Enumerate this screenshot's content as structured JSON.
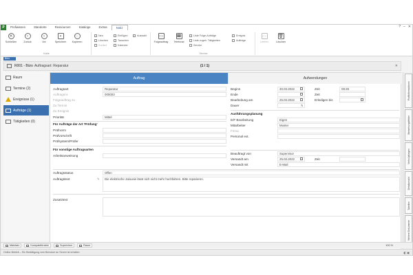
{
  "menu": {
    "tabs": [
      "Profiwissen",
      "Standorte",
      "Ressourcen",
      "Kataloge",
      "Extras",
      "Notiz"
    ],
    "active_index": 5
  },
  "ribbon": {
    "group_main": {
      "buttons": [
        "Schließen",
        "Zurück",
        "Vor",
        "Speichern",
        "Kopieren"
      ],
      "small": [
        "Neu",
        "Löschen",
        "Sortiert"
      ],
      "label": "Karte"
    },
    "group_edit": {
      "small": [
        "Einfügen",
        "Tauschen",
        "Kalender",
        "Auswahl"
      ],
      "label": ""
    },
    "group_service": {
      "buttons": [
        "Folgeauftrag",
        "Telefonat"
      ],
      "small": [
        "Liste Folge-Aufträge",
        "Liste zugeh. Tätigkeiten",
        "Service",
        "Ereignis",
        "Aufträge"
      ],
      "label": "Service"
    },
    "group_right": {
      "buttons": [
        "Leeren",
        "Löschen"
      ]
    }
  },
  "doc_tab": "Büro",
  "header": {
    "title": "R001 - Büro",
    "subtitle": "Auftragsart: Reparatur",
    "page": "(1 / 1)",
    "close": "✕"
  },
  "sidebar": {
    "items": [
      {
        "label": "Raum",
        "icon": "room-icon"
      },
      {
        "label": "Termine (2)",
        "icon": "calendar-icon"
      },
      {
        "label": "Ereignisse (1)",
        "icon": "warning-icon"
      },
      {
        "label": "Aufträge (1)",
        "icon": "order-icon",
        "active": true
      },
      {
        "label": "Tätigkeiten (0)",
        "icon": "activity-icon"
      }
    ]
  },
  "tabs": {
    "auftrag": "Auftrag",
    "aufwendungen": "Aufwendungen"
  },
  "left_form": {
    "auftragsart_label": "Auftragsart",
    "auftragsart_value": "Reparatur",
    "auftragsnr_label": "Auftragsnr.",
    "auftragsnr_value": "000003",
    "folgeauftrag_label": "Folgeauftrag zu",
    "zu_termin_label": "Zu Termin",
    "zu_ereignis_label": "Zu Ereignis",
    "prioritaet_label": "Priorität",
    "prioritaet_value": "Mittel",
    "pruefung_heading": "Für Aufträge der Art 'Prüfung'",
    "pruefnorm_label": "Prüfnorm",
    "pruefvorschrift_label": "Prüfvorschrift",
    "pruefsystem_label": "Prüfsystem/Prüfer",
    "sonstige_heading": "Für sonstige Auftragsarten",
    "arbeitsanweisung_label": "Arbeitsanweisung"
  },
  "right_form": {
    "beginn_label": "Beginn",
    "beginn_value": "30.03.2022",
    "zeit1_label": "Zeit",
    "zeit1_value": "09:28",
    "ende_label": "Ende",
    "zeit2_label": "Zeit",
    "bearb_label": "Bearbeitung am",
    "bearb_value": "25.03.2022",
    "erledigen_label": "Erledigen bis",
    "dauer_label": "Dauer",
    "dauer_unit": "h",
    "planung_heading": "Ausführungsplanung",
    "ef_label": "E/F Bearbeitung",
    "ef_value": "Eigen",
    "mitarbeiter_label": "Mitarbeiter",
    "mitarbeiter_value": "Muster",
    "firma_label": "Firma",
    "personal_label": "Personal ext.",
    "beauftragt_von_label": "Beauftragt von",
    "beauftragt_von_value": "Supervisor",
    "versandt_am_label": "Versandt am",
    "versandt_am_value": "25.03.2022",
    "zeit3_label": "Zeit",
    "versandt_mit_label": "Versandt mit",
    "versandt_mit_value": "E-Mail"
  },
  "bottom_form": {
    "status_label": "Auftragsstatus",
    "status_value": "Offen",
    "text_label": "Auftragstext",
    "text_value": "Die elektrische Jalousie lässt sich nicht mehr hochfahren. Bitte reparieren.",
    "zusatz_label": "Zusatztext"
  },
  "right_tabs": [
    "Profilinformationen",
    "Bemerkungsfelder",
    "Verknüpfungen",
    "Detailansicht",
    "Tabellen",
    "Weitere Dokumente"
  ],
  "bottom_bar": {
    "buttons": [
      "Maintain",
      "Kompaktfenster",
      "Supervisor",
      "Raum"
    ],
    "zoom": "100 %"
  },
  "status_text": "Online-Betrieb – Ein Bestätigung vom Benutzer an Server ist erhalten"
}
